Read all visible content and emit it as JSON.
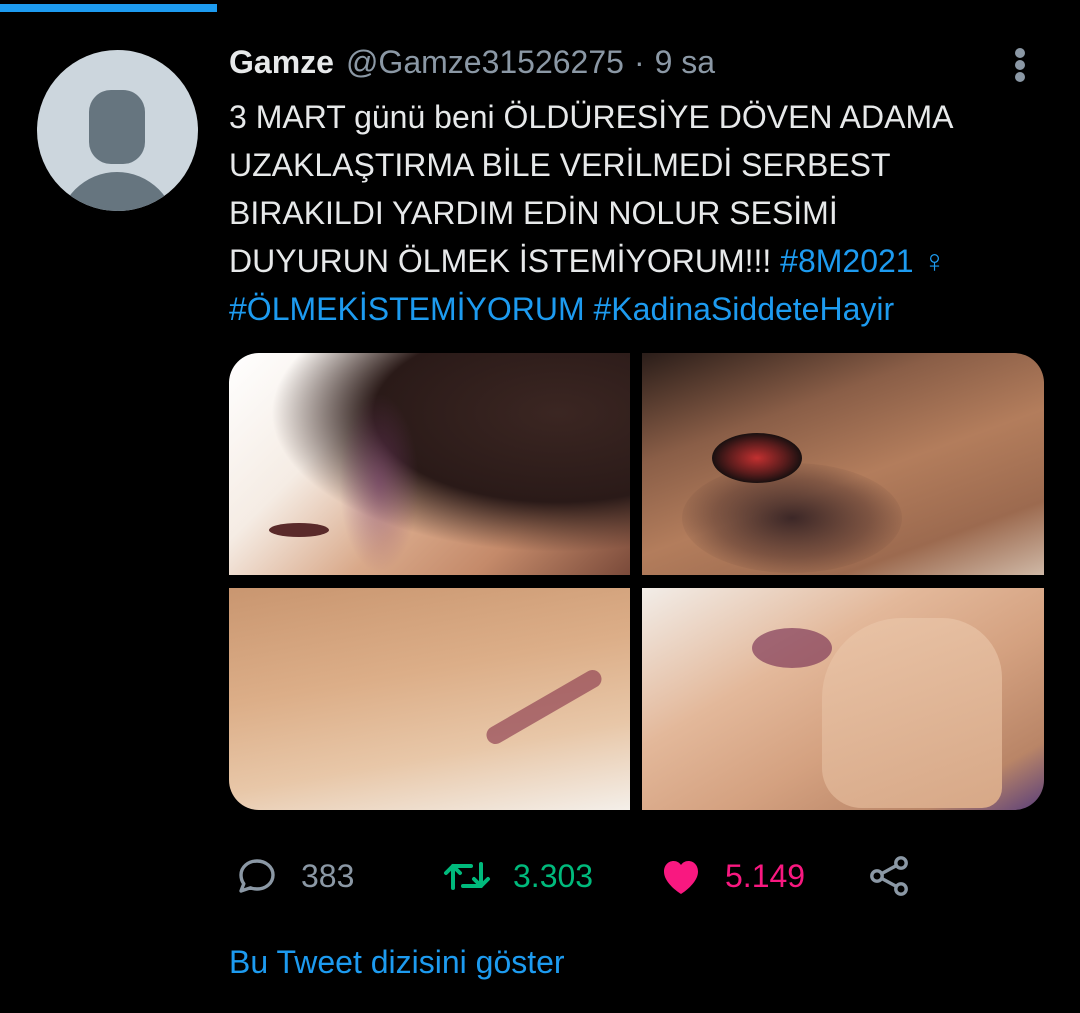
{
  "tweet": {
    "author_name": "Gamze",
    "author_handle": "@Gamze31526275",
    "separator": "·",
    "time": "9 sa",
    "text_lines": [
      "3 MART günü beni ÖLDÜRESİYE DÖVEN ADAMA",
      "UZAKLAŞTIRMA BİLE VERİLMEDİ SERBEST",
      "BIRAKILDI YARDIM EDİN NOLUR SESİMİ",
      "DUYURUN ÖLMEK İSTEMİYORUM!!!"
    ],
    "hashtags": [
      "#8M2021",
      "#ÖLMEKİSTEMİYORUM",
      "#KadinaSiddeteHayir"
    ],
    "emoji": "♀",
    "media_icons": [
      "photo-bruised-temple",
      "photo-bruised-eye",
      "photo-bruised-neck",
      "photo-bruised-lip"
    ]
  },
  "actions": {
    "reply_count": "383",
    "retweet_count": "3.303",
    "like_count": "5.149"
  },
  "thread_link": "Bu Tweet dizisini göster",
  "colors": {
    "background": "#000000",
    "text": "#e7e9ea",
    "secondary": "#8b98a5",
    "accent": "#1d9bf0",
    "retweet": "#00ba7c",
    "like": "#f91880"
  }
}
